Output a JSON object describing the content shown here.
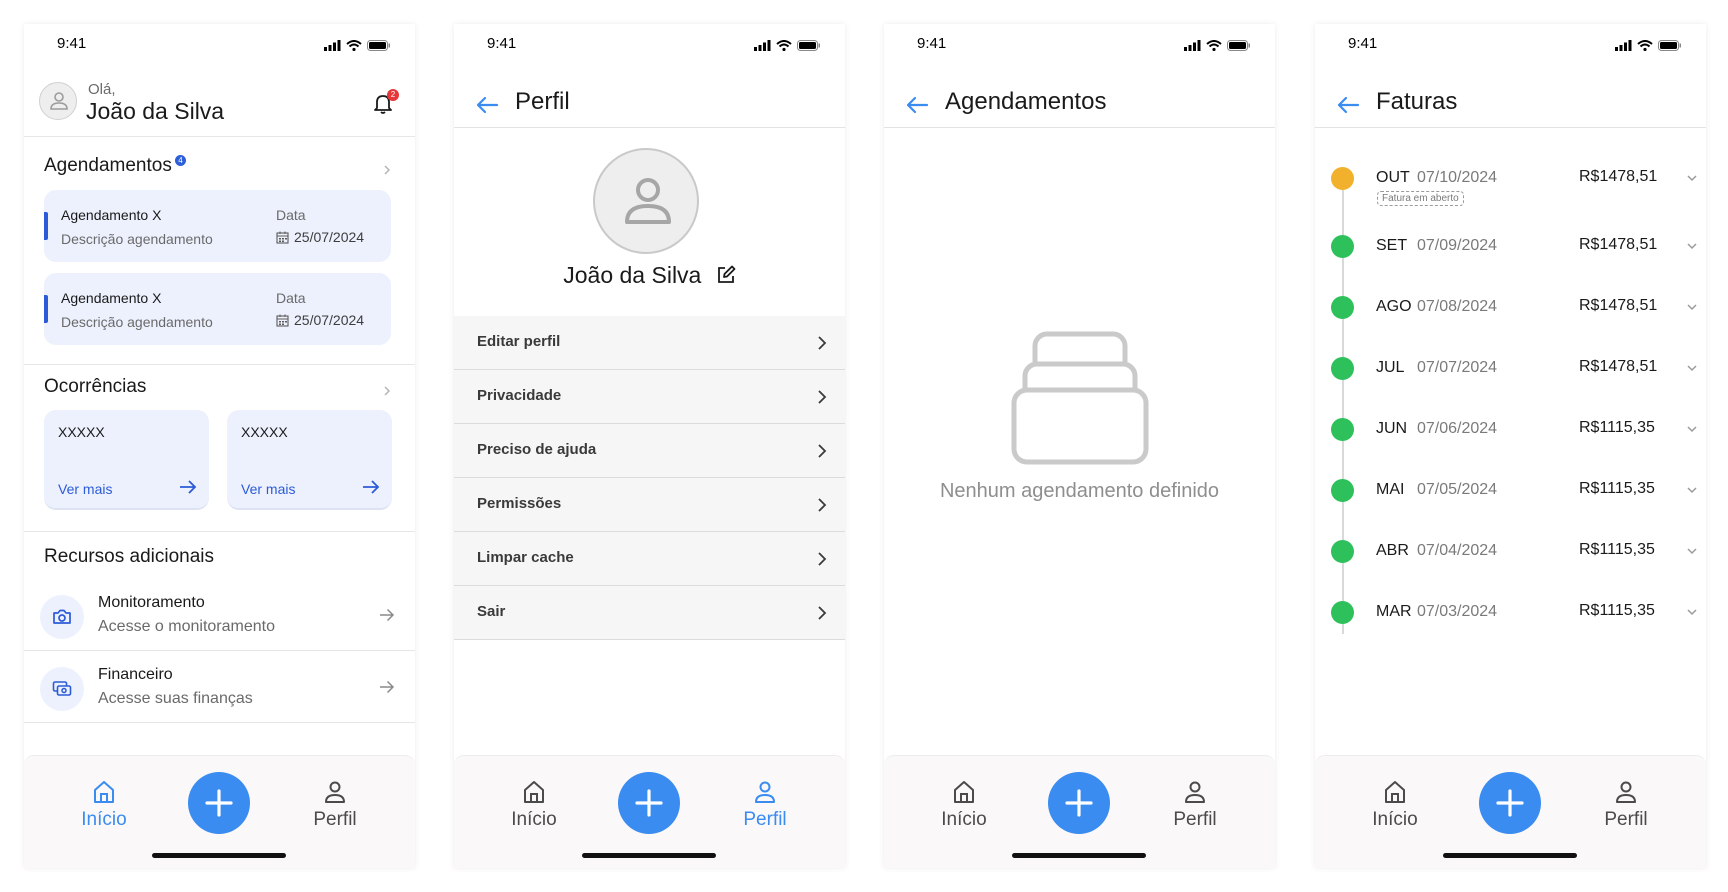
{
  "status_time": "9:41",
  "colors": {
    "accent": "#3b8cf0",
    "brand_blue": "#2b5bd7",
    "card_bg": "#edf1fd",
    "open_status": "#f2b12c",
    "paid_status": "#2ec05a"
  },
  "tabbar": {
    "home_label": "Início",
    "profile_label": "Perfil",
    "add_icon": "plus-icon"
  },
  "home": {
    "greeting": "Olá,",
    "user_name": "João da Silva",
    "notification_count": "2",
    "agendamentos": {
      "title": "Agendamentos",
      "badge": "4",
      "items": [
        {
          "name": "Agendamento X",
          "desc": "Descrição agendamento",
          "date_label": "Data",
          "date": "25/07/2024"
        },
        {
          "name": "Agendamento X",
          "desc": "Descrição agendamento",
          "date_label": "Data",
          "date": "25/07/2024"
        }
      ]
    },
    "ocorrencias": {
      "title": "Ocorrências",
      "items": [
        {
          "value": "XXXXX",
          "link": "Ver mais"
        },
        {
          "value": "XXXXX",
          "link": "Ver mais"
        }
      ]
    },
    "recursos": {
      "title": "Recursos adicionais",
      "items": [
        {
          "title": "Monitoramento",
          "subtitle": "Acesse o monitoramento",
          "icon": "camera-icon"
        },
        {
          "title": "Financeiro",
          "subtitle": "Acesse suas finanças",
          "icon": "money-icon"
        }
      ]
    }
  },
  "perfil": {
    "title": "Perfil",
    "user_name": "João da Silva",
    "menu": [
      "Editar perfil",
      "Privacidade",
      "Preciso de ajuda",
      "Permissões",
      "Limpar cache",
      "Sair"
    ]
  },
  "agendamentos_page": {
    "title": "Agendamentos",
    "empty_text": "Nenhum agendamento definido"
  },
  "faturas": {
    "title": "Faturas",
    "items": [
      {
        "month": "OUT",
        "date": "07/10/2024",
        "value": "R$1478,51",
        "status": "open",
        "tag": "Fatura em aberto"
      },
      {
        "month": "SET",
        "date": "07/09/2024",
        "value": "R$1478,51",
        "status": "paid"
      },
      {
        "month": "AGO",
        "date": "07/08/2024",
        "value": "R$1478,51",
        "status": "paid"
      },
      {
        "month": "JUL",
        "date": "07/07/2024",
        "value": "R$1478,51",
        "status": "paid"
      },
      {
        "month": "JUN",
        "date": "07/06/2024",
        "value": "R$1115,35",
        "status": "paid"
      },
      {
        "month": "MAI",
        "date": "07/05/2024",
        "value": "R$1115,35",
        "status": "paid"
      },
      {
        "month": "ABR",
        "date": "07/04/2024",
        "value": "R$1115,35",
        "status": "paid"
      },
      {
        "month": "MAR",
        "date": "07/03/2024",
        "value": "R$1115,35",
        "status": "paid"
      }
    ]
  }
}
